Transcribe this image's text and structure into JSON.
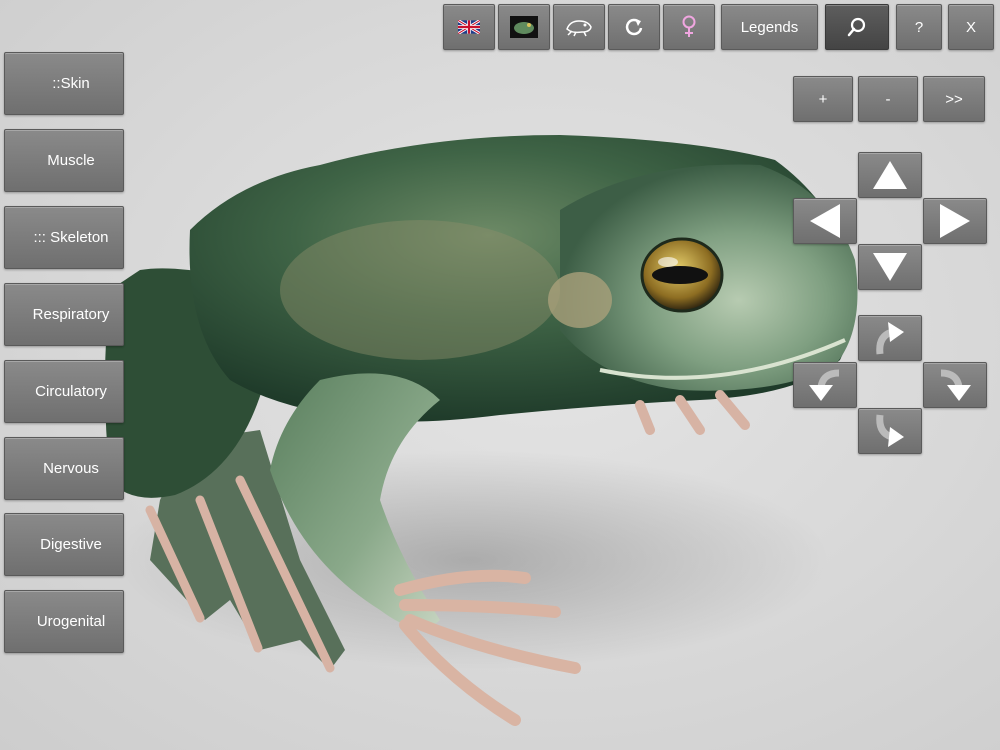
{
  "toolbar": {
    "legends_label": "Legends",
    "help_label": "?",
    "close_label": "X"
  },
  "sidebar": {
    "items": [
      {
        "label": "::Skin"
      },
      {
        "label": "Muscle"
      },
      {
        "label": "::: Skeleton"
      },
      {
        "label": "Respiratory"
      },
      {
        "label": "Circulatory"
      },
      {
        "label": "Nervous"
      },
      {
        "label": "Digestive"
      },
      {
        "label": "Urogenital"
      }
    ]
  },
  "zoom": {
    "plus_label": "+",
    "minus_label": "-",
    "next_label": ">>"
  },
  "colors": {
    "button_bg": "#7a7a7a",
    "frog_green": "#4a6e4e",
    "female_symbol": "#f0a6e0"
  }
}
